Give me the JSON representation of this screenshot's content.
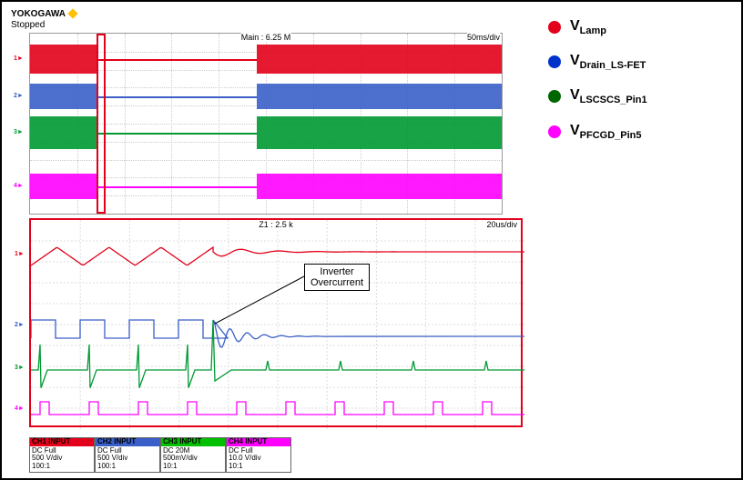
{
  "brand": "YOKOGAWA",
  "status": "Stopped",
  "top_plot": {
    "header_left": "Main : 6.25 M",
    "header_right": "50ms/div",
    "zoom_window": {
      "left_pct": 14,
      "width_pct": 2
    },
    "channels": [
      {
        "name": "CH1",
        "color": "#e2001a",
        "band_top_pct": 6,
        "band_h_pct": 16,
        "line_pct": 14,
        "collapse_at_pct": 48
      },
      {
        "name": "CH2",
        "color": "#3a5fc8",
        "band_top_pct": 28,
        "band_h_pct": 14,
        "line_pct": 35,
        "collapse_at_pct": 48
      },
      {
        "name": "CH3",
        "color": "#009933",
        "band_top_pct": 46,
        "band_h_pct": 18,
        "line_pct": 55,
        "collapse_at_pct": 48
      },
      {
        "name": "CH4",
        "color": "#ff00ff",
        "band_top_pct": 78,
        "band_h_pct": 14,
        "line_pct": 85,
        "collapse_at_pct": 48
      }
    ]
  },
  "bottom_plot": {
    "header_left": "Z1 : 2.5 k",
    "header_right": "20us/div",
    "annotation": {
      "line1": "Inverter",
      "line2": "Overcurrent"
    },
    "ch1_ripple": {
      "y_base": 40,
      "amp": 10,
      "cycles": 3.5,
      "stop_x": 200,
      "flat_y": 35
    },
    "ch2_square": {
      "y_hi": 110,
      "y_lo": 130,
      "period": 54,
      "stop_x": 200,
      "flat_y": 128
    },
    "ch3_spikes": {
      "y_base": 165,
      "spike_amp": 28,
      "period": 54,
      "stop_x": 200,
      "overshoot_x": 200,
      "overshoot_amp": 55
    },
    "ch4_pulses": {
      "y_hi": 200,
      "y_lo": 214,
      "period": 54,
      "pw": 10,
      "count": 10
    }
  },
  "channel_info": [
    {
      "hdr": "CH1  INPUT",
      "hdr_cls": "hdr-ch1",
      "l1": "DC Full",
      "l2": "500 V/div",
      "l3": "100:1"
    },
    {
      "hdr": "CH2  INPUT",
      "hdr_cls": "hdr-ch2",
      "l1": "DC Full",
      "l2": "500 V/div",
      "l3": "100:1"
    },
    {
      "hdr": "CH3  INPUT",
      "hdr_cls": "hdr-ch3",
      "l1": "DC 20M",
      "l2": "500mV/div",
      "l3": "10:1"
    },
    {
      "hdr": "CH4  INPUT",
      "hdr_cls": "hdr-ch4",
      "l1": "DC Full",
      "l2": "10.0 V/div",
      "l3": "10:1"
    }
  ],
  "legend": [
    {
      "color": "c-red",
      "prefix": "V",
      "sub": "Lamp"
    },
    {
      "color": "c-blue",
      "prefix": "V",
      "sub": "Drain_LS-FET"
    },
    {
      "color": "c-green",
      "prefix": "V",
      "sub": "LSCSCS_Pin1"
    },
    {
      "color": "c-mag",
      "prefix": "V",
      "sub": "PFCGD_Pin5"
    }
  ],
  "chart_data": {
    "type": "oscilloscope",
    "title": "Inverter Overcurrent event capture",
    "main_window": {
      "record": "6.25 M",
      "time_per_div": "50 ms/div",
      "event_time_div": 1.5,
      "resume_time_div": 4.8
    },
    "zoom_window": {
      "record": "2.5 k",
      "time_per_div": "20 us/div",
      "event_time_div": 3.6
    },
    "series": [
      {
        "name": "V_Lamp",
        "ch": 1,
        "scale": "500 V/div",
        "coupling": "DC Full",
        "probe": "100:1",
        "color": "#e2001a"
      },
      {
        "name": "V_Drain_LS-FET",
        "ch": 2,
        "scale": "500 V/div",
        "coupling": "DC Full",
        "probe": "100:1",
        "color": "#0033cc"
      },
      {
        "name": "V_LSCSCS_Pin1",
        "ch": 3,
        "scale": "500 mV/div",
        "coupling": "DC 20M",
        "probe": "10:1",
        "color": "#006600"
      },
      {
        "name": "V_PFCGD_Pin5",
        "ch": 4,
        "scale": "10.0 V/div",
        "coupling": "DC Full",
        "probe": "10:1",
        "color": "#ff00ff"
      }
    ],
    "annotation": "Inverter Overcurrent"
  }
}
